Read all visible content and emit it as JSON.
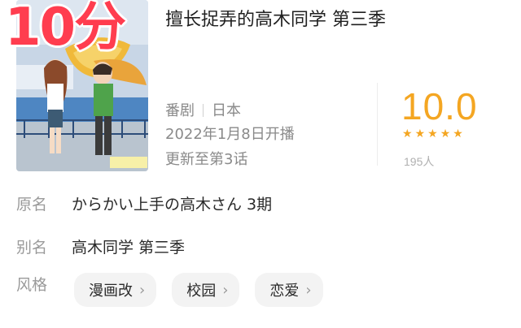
{
  "overlay_text": "10分",
  "anime": {
    "title": "擅长捉弄的高木同学 第三季",
    "type": "番剧",
    "region": "日本",
    "premiere": "2022年1月8日开播",
    "update": "更新至第3话"
  },
  "rating": {
    "score": "10.0",
    "stars": 5,
    "star_icon": "★",
    "votes": "195人"
  },
  "info": {
    "original_name_label": "原名",
    "original_name": "からかい上手の高木さん 3期",
    "alias_label": "别名",
    "alias": "高木同学 第三季",
    "style_label": "风格"
  },
  "tags": [
    {
      "label": "漫画改",
      "chevron": "›"
    },
    {
      "label": "校园",
      "chevron": "›"
    },
    {
      "label": "恋爱",
      "chevron": "›"
    }
  ],
  "colors": {
    "accent": "#f4a622",
    "overlay": "#ff3d4f",
    "tag_bg": "#f3f3f3"
  }
}
